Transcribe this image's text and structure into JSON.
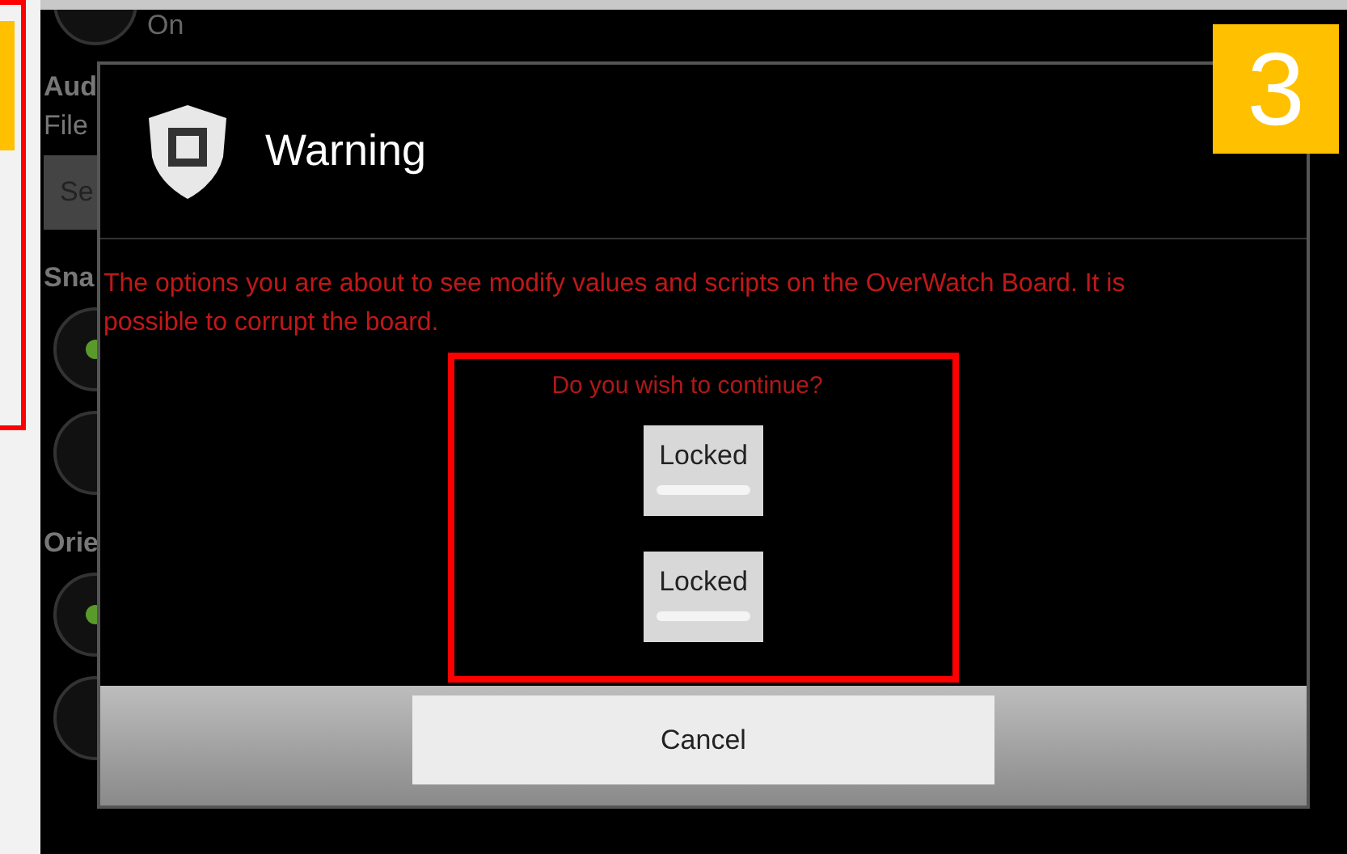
{
  "background": {
    "top_option": {
      "label": "On",
      "selected": false
    },
    "items": [
      {
        "kind": "heading",
        "text": "Aud"
      },
      {
        "kind": "text",
        "text": "File"
      },
      {
        "kind": "button",
        "text": "Se"
      },
      {
        "kind": "heading",
        "text": "Sna"
      },
      {
        "kind": "radio",
        "selected": true
      },
      {
        "kind": "radio",
        "selected": false
      },
      {
        "kind": "heading",
        "text": "Orie"
      },
      {
        "kind": "radio",
        "selected": true
      },
      {
        "kind": "radio",
        "selected": false
      }
    ]
  },
  "dialog": {
    "title": "Warning",
    "message": "The options you are about to see modify values and scripts on the OverWatch Board. It is possible to corrupt the board.",
    "question": "Do you wish to continue?",
    "toggles": [
      {
        "label": "Locked",
        "on": false
      },
      {
        "label": "Locked",
        "on": false
      }
    ],
    "cancel": "Cancel"
  },
  "annotation": {
    "step": "3"
  }
}
